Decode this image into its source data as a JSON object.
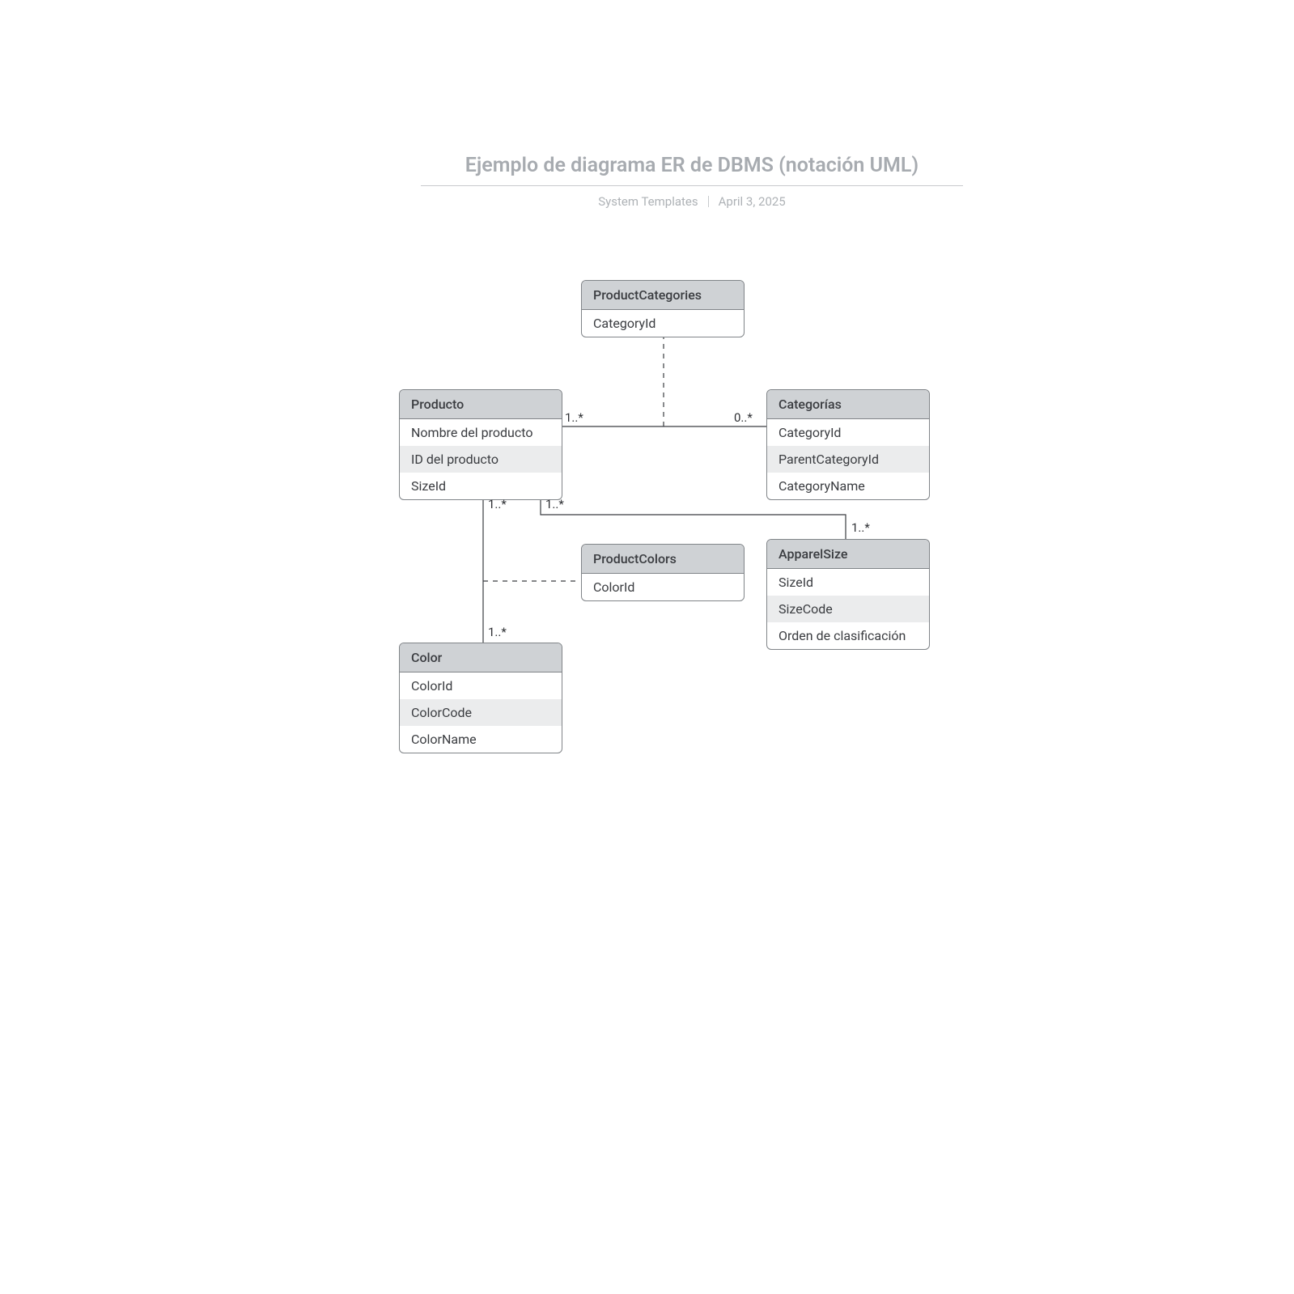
{
  "header": {
    "title": "Ejemplo de diagrama ER de DBMS (notación UML)",
    "author": "System Templates",
    "date": "April 3, 2025"
  },
  "entities": {
    "productCategories": {
      "name": "ProductCategories",
      "attrs": [
        "CategoryId"
      ]
    },
    "producto": {
      "name": "Producto",
      "attrs": [
        "Nombre del producto",
        "ID del producto",
        "SizeId"
      ]
    },
    "categorias": {
      "name": "Categorías",
      "attrs": [
        "CategoryId",
        "ParentCategoryId",
        "CategoryName"
      ]
    },
    "productColors": {
      "name": "ProductColors",
      "attrs": [
        "ColorId"
      ]
    },
    "apparelSize": {
      "name": "ApparelSize",
      "attrs": [
        "SizeId",
        "SizeCode",
        "Orden de clasificación"
      ]
    },
    "color": {
      "name": "Color",
      "attrs": [
        "ColorId",
        "ColorCode",
        "ColorName"
      ]
    }
  },
  "mult": {
    "prod_cat_left": "1..*",
    "prod_cat_right": "0..*",
    "prod_size_top": "1..*",
    "prod_size_bot": "1..*",
    "prod_color_top": "1..*",
    "prod_color_bot": "1..*"
  }
}
